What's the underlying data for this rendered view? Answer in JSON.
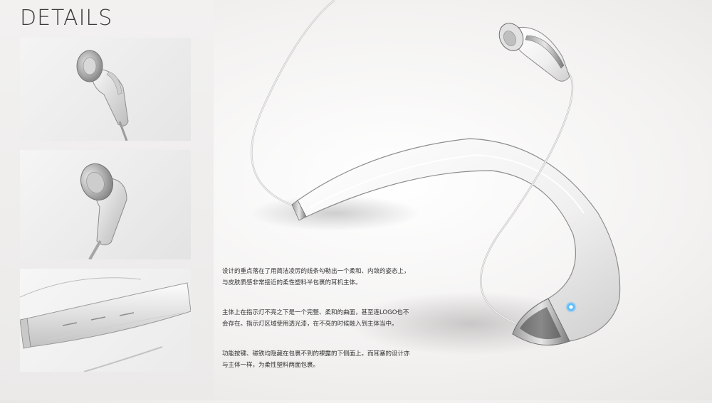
{
  "header": {
    "title": "DETAILS"
  },
  "thumbnails": [
    {
      "subject": "earbud-closeup"
    },
    {
      "subject": "earbud-angle"
    },
    {
      "subject": "neckband-buttons"
    }
  ],
  "hero": {
    "subject": "neckband-headset",
    "indicator_color": "#4fb8ff"
  },
  "description": {
    "paragraphs": [
      {
        "lines": [
          "设计的重点落在了用简洁凌厉的线条勾勒出一个柔和、内敛的姿态上，",
          "与皮肤质感非常接近的柔性塑料半包裹的耳机主体。"
        ]
      },
      {
        "lines": [
          "主体上在指示灯不亮之下是一个完整、柔和的曲面，甚至连LOGO也不",
          "会存在。指示灯区域使用透光漆，在不亮的时候融入到主体当中。"
        ]
      },
      {
        "lines": [
          "功能按键、磁铁均隐藏在包裹不到的裸露的下侧面上。而耳塞的设计亦",
          "与主体一样，为柔性塑料两面包裹。"
        ]
      }
    ]
  }
}
